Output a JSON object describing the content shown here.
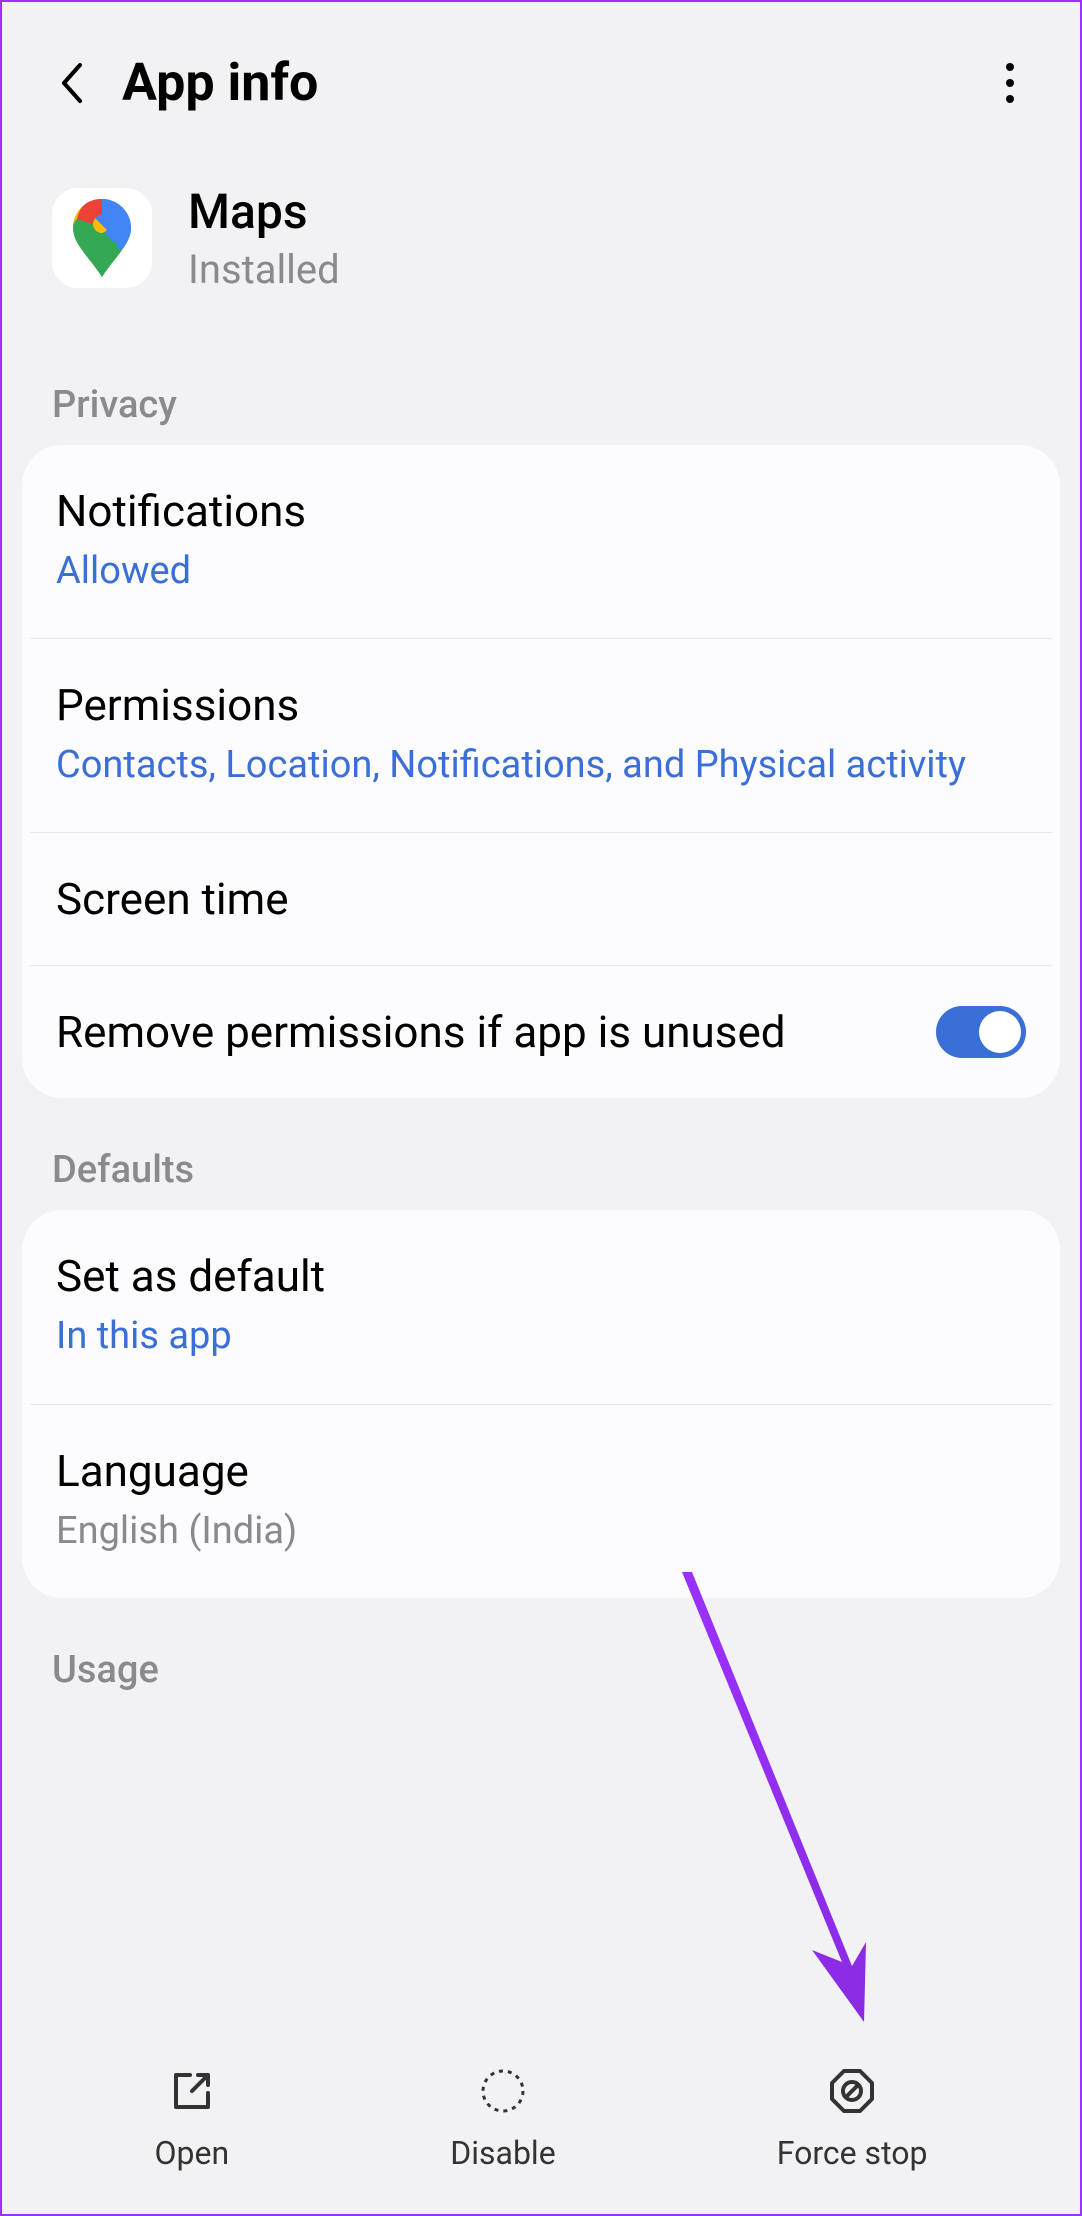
{
  "header": {
    "title": "App info"
  },
  "app": {
    "name": "Maps",
    "status": "Installed"
  },
  "sections": {
    "privacy": {
      "label": "Privacy",
      "notifications": {
        "title": "Notifications",
        "subtitle": "Allowed"
      },
      "permissions": {
        "title": "Permissions",
        "subtitle": "Contacts, Location, Notifications, and Physical activity"
      },
      "screen_time": {
        "title": "Screen time"
      },
      "remove_perms": {
        "title": "Remove permissions if app is unused",
        "enabled": true
      }
    },
    "defaults": {
      "label": "Defaults",
      "set_default": {
        "title": "Set as default",
        "subtitle": "In this app"
      },
      "language": {
        "title": "Language",
        "subtitle": "English (India)"
      }
    },
    "usage": {
      "label": "Usage"
    }
  },
  "bottom": {
    "open": "Open",
    "disable": "Disable",
    "force_stop": "Force stop"
  }
}
